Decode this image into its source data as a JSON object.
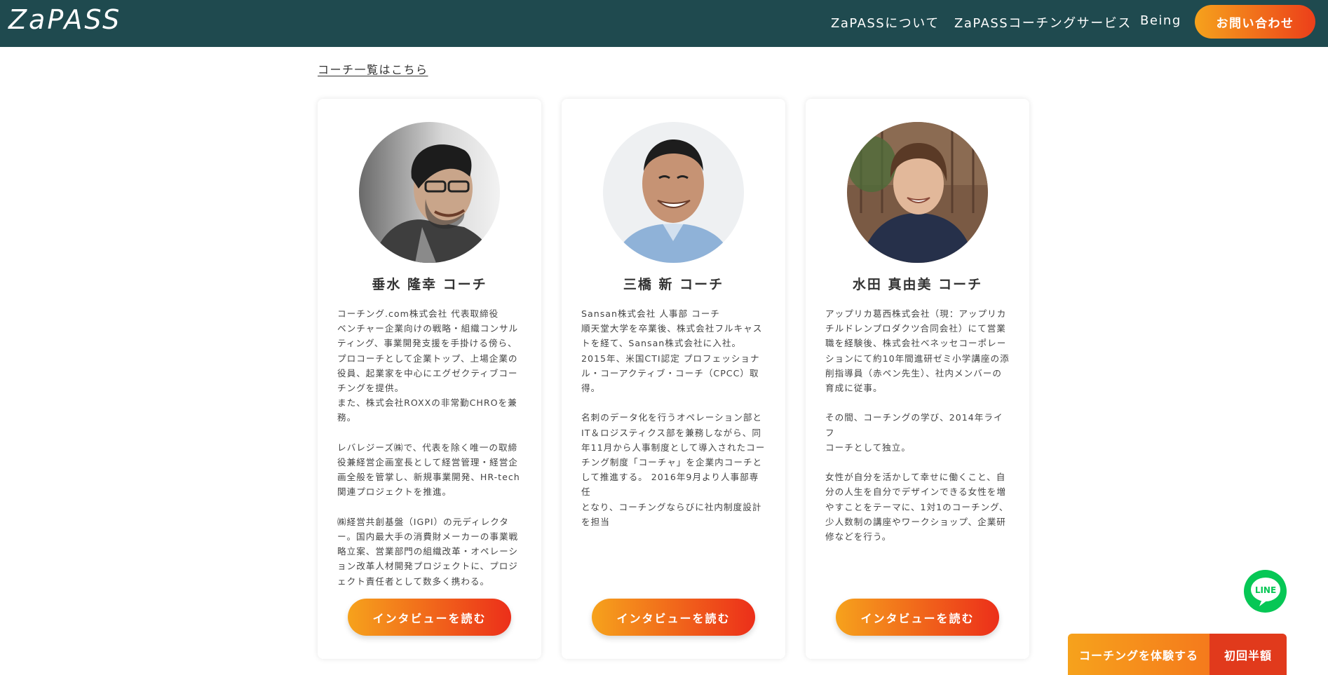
{
  "header": {
    "logo": "ZaPASS",
    "nav": [
      {
        "label": "ZaPASSについて"
      },
      {
        "label": "ZaPASSコーチングサービス"
      },
      {
        "label": "Being"
      }
    ],
    "contact_label": "お問い合わせ"
  },
  "coach_list_link": "コーチ一覧はこちら",
  "coaches": [
    {
      "name": "垂水 隆幸 コーチ",
      "bio": "コーチング.com株式会社 代表取締役\nベンチャー企業向けの戦略・組織コンサル\nティング、事業開発支援を手掛ける傍ら、\nプロコーチとして企業トップ、上場企業の\n役員、起業家を中心にエグゼクティブコー\nチングを提供。\nまた、株式会社ROXXの非常勤CHROを兼\n務。\n\nレバレジーズ㈱で、代表を除く唯一の取締\n役兼経営企画室長として経営管理・経営企\n画全般を管掌し、新規事業開発、HR-tech\n関連プロジェクトを推進。\n\n㈱経営共創基盤（IGPI）の元ディレクタ\nー。国内最大手の消費財メーカーの事業戦\n略立案、営業部門の組織改革・オペレーシ\nョン改革人材開発プロジェクトに、プロジ\nェクト責任者として数多く携わる。",
      "button": "インタビューを読む"
    },
    {
      "name": "三橋 新 コーチ",
      "bio": "Sansan株式会社 人事部 コーチ\n順天堂大学を卒業後、株式会社フルキャス\nトを経て、Sansan株式会社に入社。\n2015年、米国CTI認定 プロフェッショナ\nル・コーアクティブ・コーチ（CPCC）取\n得。\n\n名刺のデータ化を行うオペレーション部と\nIT＆ロジスティクス部を兼務しながら、同\n年11月から人事制度として導入されたコー\nチング制度「コーチャ」を企業内コーチと\nして推進する。 2016年9月より人事部専任\nとなり、コーチングならびに社内制度設計\nを担当",
      "button": "インタビューを読む"
    },
    {
      "name": "水田 真由美 コーチ",
      "bio": "アップリカ葛西株式会社（現：アップリカ\nチルドレンプロダクツ合同会社）にて営業\n職を経験後、株式会社ベネッセコーポレー\nションにて約10年間進研ゼミ小学講座の添\n削指導員（赤ペン先生）、社内メンバーの\n育成に従事。\n\nその間、コーチングの学び、2014年ライフ\nコーチとして独立。\n\n女性が自分を活かして幸せに働くこと、自\n分の人生を自分でデザインできる女性を増\nやすことをテーマに、1対1のコーチング、\n少人数制の講座やワークショップ、企業研\n修などを行う。",
      "button": "インタビューを読む"
    }
  ],
  "line_badge": "LINE",
  "cta": {
    "label": "コーチングを体験する",
    "badge": "初回半額"
  },
  "colors": {
    "header_bg": "#1f4a4f",
    "accent_start": "#f6a21c",
    "accent_end": "#ec3f1a",
    "line_green": "#06c755"
  }
}
